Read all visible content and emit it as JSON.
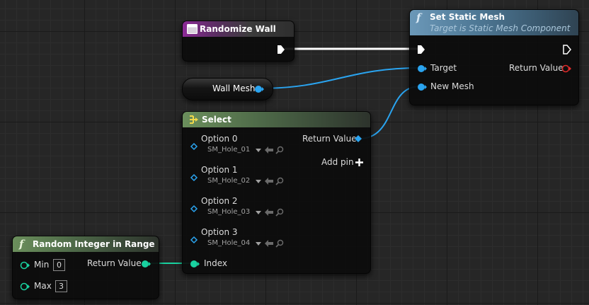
{
  "randomize_wall": {
    "title": "Randomize Wall",
    "header_color": "#8c2a96"
  },
  "set_static_mesh": {
    "title": "Set Static Mesh",
    "subtitle": "Target is Static Mesh Component",
    "target_label": "Target",
    "new_mesh_label": "New Mesh",
    "return_value_label": "Return Value",
    "header_color": "#6b98b8"
  },
  "wall_mesh": {
    "label": "Wall Mesh",
    "pin_color": "#2aa4f0"
  },
  "select": {
    "title": "Select",
    "return_value_label": "Return Value",
    "add_pin_label": "Add pin",
    "index_label": "Index",
    "header_color": "#6b8f5c",
    "options": [
      {
        "label": "Option 0",
        "value": "SM_Hole_01"
      },
      {
        "label": "Option 1",
        "value": "SM_Hole_02"
      },
      {
        "label": "Option 2",
        "value": "SM_Hole_03"
      },
      {
        "label": "Option 3",
        "value": "SM_Hole_04"
      }
    ]
  },
  "random_integer": {
    "title": "Random Integer in Range",
    "min_label": "Min",
    "min_value": "0",
    "max_label": "Max",
    "max_value": "3",
    "return_value_label": "Return Value",
    "pin_color": "#19d2a0"
  },
  "icons": {
    "event": "event-icon",
    "function": "function-icon",
    "select": "select-icon",
    "exec": "exec-pin-icon",
    "dropdown": "dropdown-arrow-icon",
    "use_selected": "use-selected-arrow-icon",
    "browse": "browse-magnifier-icon",
    "add": "add-pin-icon"
  }
}
